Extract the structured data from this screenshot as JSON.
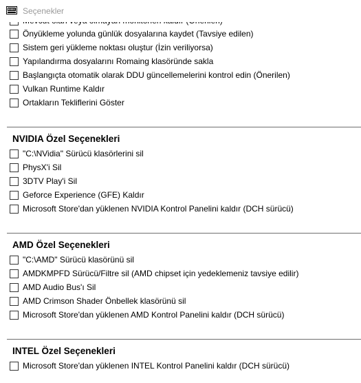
{
  "window": {
    "title": "Seçenekler"
  },
  "general": {
    "items": [
      "Mevcut olan veya olmayan monitörleri kaldır (Önerilen)",
      "Önyükleme yolunda günlük dosyalarına kaydet (Tavsiye edilen)",
      "Sistem geri yükleme noktası oluştur (İzin veriliyorsa)",
      "Yapılandırma dosyalarını Romaing klasöründe sakla",
      "Başlangıçta otomatik olarak DDU güncellemelerini kontrol edin (Önerilen)",
      "Vulkan Runtime Kaldır",
      "Ortakların Tekliflerini Göster"
    ]
  },
  "nvidia": {
    "title": "NVIDIA Özel Seçenekleri",
    "items": [
      "\"C:\\NVidia\" Sürücü klasörlerini sil",
      "PhysX'i Sil",
      "3DTV Play'i Sil",
      "Geforce Experience (GFE) Kaldır",
      "Microsoft Store'dan yüklenen NVIDIA Kontrol Panelini kaldır (DCH sürücü)"
    ]
  },
  "amd": {
    "title": "AMD Özel Seçenekleri",
    "items": [
      "\"C:\\AMD\" Sürücü klasörünü sil",
      "AMDKMPFD Sürücü/Filtre sil (AMD chipset için yedeklemeniz tavsiye edilir)",
      "AMD Audio Bus'ı Sil",
      "AMD Crimson Shader Önbellek klasörünü sil",
      "Microsoft Store'dan yüklenen AMD Kontrol Panelini kaldır (DCH sürücü)"
    ]
  },
  "intel": {
    "title": "INTEL Özel Seçenekleri",
    "items": [
      "Microsoft Store'dan yüklenen INTEL Kontrol Panelini kaldır (DCH sürücü)"
    ]
  }
}
